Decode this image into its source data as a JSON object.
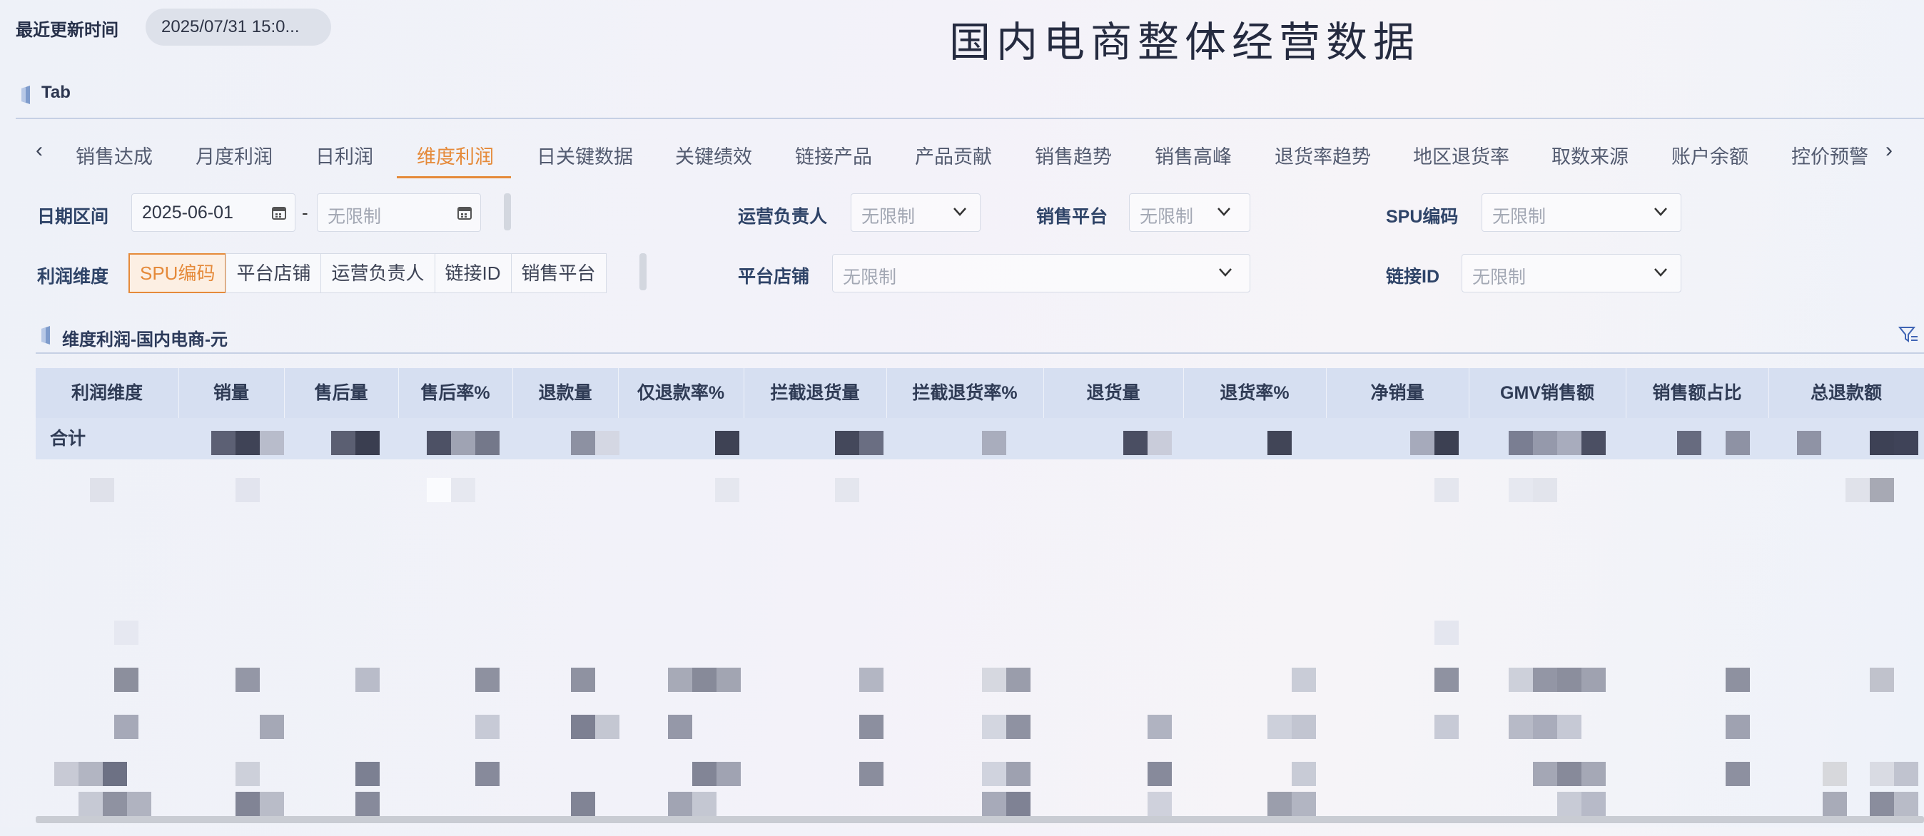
{
  "header": {
    "update_label": "最近更新时间",
    "update_time": "2025/07/31 15:0...",
    "title": "国内电商整体经营数据"
  },
  "tab_section": {
    "title": "Tab"
  },
  "tabs": {
    "items": [
      "销售达成",
      "月度利润",
      "日利润",
      "维度利润",
      "日关键数据",
      "关键绩效",
      "链接产品",
      "产品贡献",
      "销售趋势",
      "销售高峰",
      "退货率趋势",
      "地区退货率",
      "取数来源",
      "账户余额",
      "控价预警"
    ],
    "active_index": 3,
    "accent_color": "#e58a3a"
  },
  "filters": {
    "date_range": {
      "label": "日期区间",
      "start_value": "2025-06-01",
      "separator": "-",
      "end_placeholder": "无限制"
    },
    "operator": {
      "label": "运营负责人",
      "placeholder": "无限制"
    },
    "platform": {
      "label": "销售平台",
      "placeholder": "无限制"
    },
    "spu": {
      "label": "SPU编码",
      "placeholder": "无限制"
    },
    "dimension": {
      "label": "利润维度",
      "options": [
        "SPU编码",
        "平台店铺",
        "运营负责人",
        "链接ID",
        "销售平台"
      ],
      "active_index": 0
    },
    "shop": {
      "label": "平台店铺",
      "placeholder": "无限制"
    },
    "link": {
      "label": "链接ID",
      "placeholder": "无限制"
    }
  },
  "section": {
    "title": "维度利润-国内电商-元"
  },
  "table": {
    "columns": [
      "利润维度",
      "销量",
      "售后量",
      "售后率%",
      "退款量",
      "仅退款率%",
      "拦截退货量",
      "拦截退货率%",
      "退货量",
      "退货率%",
      "净销量",
      "GMV销售额",
      "销售额占比",
      "总退款额"
    ],
    "total_label": "合计"
  }
}
